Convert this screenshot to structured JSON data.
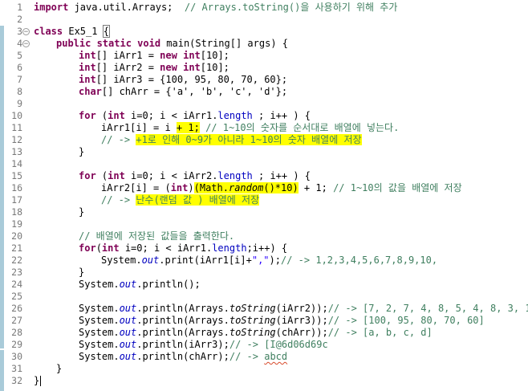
{
  "editor": {
    "line_numbers": [
      "1",
      "2",
      "3",
      "4",
      "5",
      "6",
      "7",
      "8",
      "9",
      "10",
      "11",
      "12",
      "13",
      "14",
      "15",
      "16",
      "17",
      "18",
      "19",
      "20",
      "21",
      "22",
      "23",
      "24",
      "25",
      "26",
      "27",
      "28",
      "29",
      "30",
      "31",
      "32"
    ],
    "fold_marker": "−",
    "code": {
      "l1": {
        "kw": "import",
        "text": " java.util.Arrays;  ",
        "comment": "// Arrays.toString()을 사용하기 위해 추가"
      },
      "l3": {
        "kw": "class",
        "text": " Ex5_1 ",
        "brace": "{"
      },
      "l4": {
        "kw": "public static void",
        "text": " main(String[] args) {"
      },
      "l5": {
        "kw1": "int",
        "a": "[] iArr1 = ",
        "kw2": "new",
        "sp": " ",
        "kw3": "int",
        "b": "[10];"
      },
      "l6": {
        "kw1": "int",
        "a": "[] iArr2 = ",
        "kw2": "new",
        "sp": " ",
        "kw3": "int",
        "b": "[10];"
      },
      "l7": {
        "kw": "int",
        "text": "[] iArr3 = {100, 95, 80, 70, 60};"
      },
      "l8": {
        "kw": "char",
        "text": "[] chArr = {'a', 'b', 'c', 'd'};"
      },
      "l10": {
        "kw1": "for",
        "a": " (",
        "kw2": "int",
        "b": " i=0; i < iArr1.",
        "fd": "length",
        "c": " ; i++ ) {"
      },
      "l11": {
        "a": "iArr1[i] = i ",
        "hl": "+ 1;",
        "b": " ",
        "comment": "// 1~10의 숫자를 순서대로 배열에 넣는다."
      },
      "l12": {
        "comment": "// -> ",
        "hl": "+1로 인해 0~9가 아니라 1~10의 숫자 배열에 저장"
      },
      "l13": {
        "text": "}"
      },
      "l15": {
        "kw1": "for",
        "a": " (",
        "kw2": "int",
        "b": " i=0; i < iArr2.",
        "fd": "length",
        "c": " ; i++ ) {"
      },
      "l16": {
        "a": "iArr2[i] = (",
        "kw": "int",
        "b": ")",
        "hl_a": "(Math.",
        "hl_it": "random",
        "hl_b": "()*10)",
        "c": " + 1; ",
        "comment": "// 1~10의 값을 배열에 저장"
      },
      "l17": {
        "comment": "// -> ",
        "hl": "난수(랜덤 값 ) 배열에 저장"
      },
      "l18": {
        "text": "}"
      },
      "l20": {
        "comment": "// 배열에 저장된 값들을 출력한다."
      },
      "l21": {
        "kw1": "for",
        "a": "(",
        "kw2": "int",
        "b": " i=0; i < iArr1.",
        "fd": "length",
        "c": ";i++) {"
      },
      "l22": {
        "a": "System.",
        "st": "out",
        "b": ".print(iArr1[i]+",
        "str": "\",\"",
        "c": ");",
        "comment": "// -> 1,2,3,4,5,6,7,8,9,10,"
      },
      "l23": {
        "text": "}"
      },
      "l24": {
        "a": "System.",
        "st": "out",
        "b": ".println();"
      },
      "l26": {
        "a": "System.",
        "st": "out",
        "b": ".println(Arrays.",
        "it": "toString",
        "c": "(iArr2));",
        "comment": "// -> [7, 2, 7, 4, 8, 5, 4, 8, 3, 1]"
      },
      "l27": {
        "a": "System.",
        "st": "out",
        "b": ".println(Arrays.",
        "it": "toString",
        "c": "(iArr3));",
        "comment": "// -> [100, 95, 80, 70, 60]"
      },
      "l28": {
        "a": "System.",
        "st": "out",
        "b": ".println(Arrays.",
        "it": "toString",
        "c": "(chArr));",
        "comment": "// -> [a, b, c, d]"
      },
      "l29": {
        "a": "System.",
        "st": "out",
        "b": ".println(iArr3);",
        "comment": "// -> [I@6d06d69c"
      },
      "l30": {
        "a": "System.",
        "st": "out",
        "b": ".println(chArr);",
        "comment_a": "// -> ",
        "comment_b": "abcd"
      },
      "l31": {
        "text": "}"
      },
      "l32": {
        "text": "}"
      }
    }
  },
  "colors": {
    "keyword": "#7f0055",
    "comment": "#3f7f5f",
    "field": "#0000c0",
    "string": "#2a00ff",
    "highlight": "#ffff00",
    "change_bar": "#a9cbd9",
    "line_number": "#787878"
  }
}
